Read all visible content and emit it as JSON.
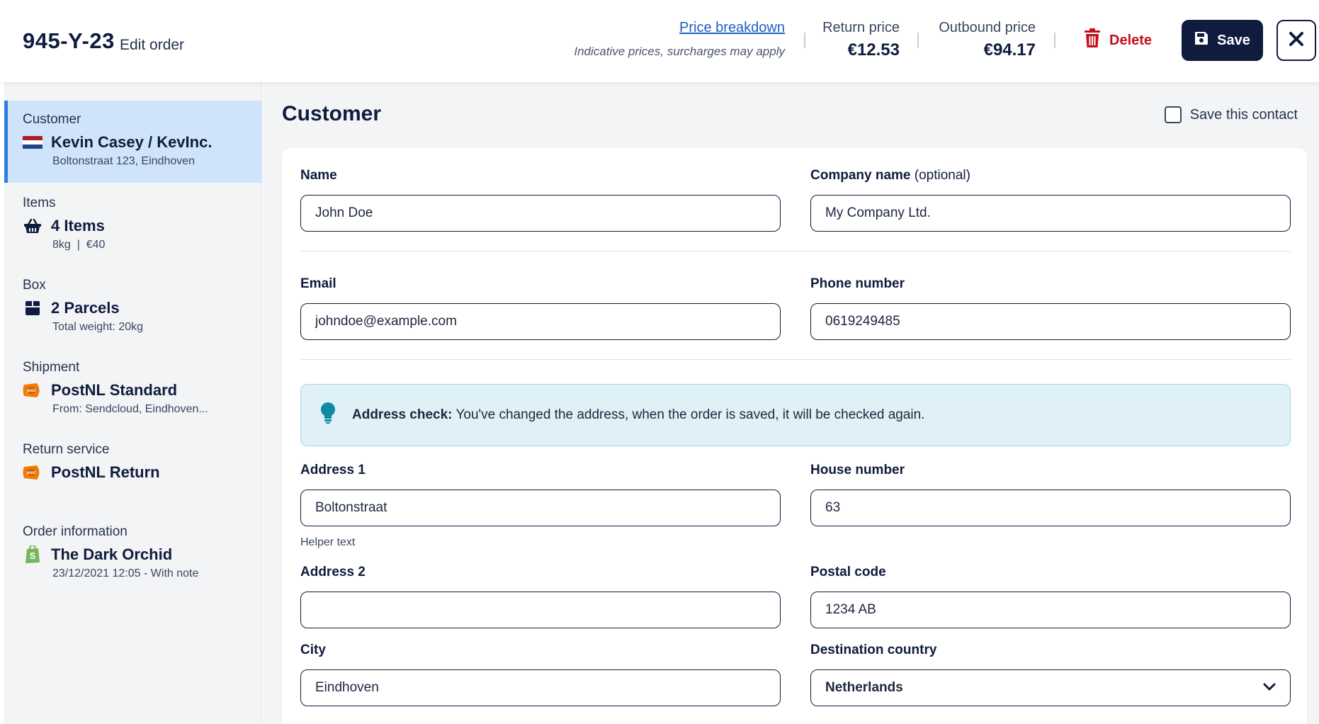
{
  "header": {
    "order_id": "945-Y-23",
    "edit_label": "Edit order",
    "price_breakdown": "Price breakdown",
    "indicative_note": "Indicative prices, surcharges may apply",
    "return_price_label": "Return price",
    "return_price_value": "€12.53",
    "outbound_price_label": "Outbound price",
    "outbound_price_value": "€94.17",
    "delete_label": "Delete",
    "save_label": "Save"
  },
  "sidebar": {
    "items": [
      {
        "category": "Customer",
        "title": "Kevin Casey / KevInc.",
        "subtitle": "Boltonstraat 123, Eindhoven",
        "icon": "netherlands-flag-icon"
      },
      {
        "category": "Items",
        "title": "4 Items",
        "subtitle": "8kg  |  €40",
        "icon": "basket-icon"
      },
      {
        "category": "Box",
        "title": "2 Parcels",
        "subtitle": "Total weight: 20kg",
        "icon": "box-icon"
      },
      {
        "category": "Shipment",
        "title": "PostNL Standard",
        "subtitle": "From: Sendcloud, Eindhoven...",
        "icon": "postnl-icon"
      },
      {
        "category": "Return service",
        "title": "PostNL Return",
        "subtitle": "",
        "icon": "postnl-icon"
      },
      {
        "category": "Order information",
        "title": "The Dark Orchid",
        "subtitle": "23/12/2021 12:05 - With note",
        "icon": "shopify-icon"
      }
    ]
  },
  "main": {
    "title": "Customer",
    "save_contact_label": "Save this contact",
    "fields": {
      "name": {
        "label": "Name",
        "value": "John Doe"
      },
      "company": {
        "label": "Company name",
        "optional": "(optional)",
        "value": "My Company Ltd."
      },
      "email": {
        "label": "Email",
        "value": "johndoe@example.com"
      },
      "phone": {
        "label": "Phone number",
        "value": "0619249485"
      },
      "address1": {
        "label": "Address 1",
        "value": "Boltonstraat",
        "helper": "Helper text"
      },
      "house_number": {
        "label": "House number",
        "value": "63"
      },
      "address2": {
        "label": "Address 2",
        "value": ""
      },
      "postal_code": {
        "label": "Postal code",
        "value": "1234 AB"
      },
      "city": {
        "label": "City",
        "value": "Eindhoven"
      },
      "country": {
        "label": "Destination country",
        "value": "Netherlands"
      }
    },
    "alert": {
      "bold": "Address check:",
      "text": "You've changed the address, when the order is saved, it will be checked again."
    }
  },
  "colors": {
    "navy": "#0f1c3d",
    "link_blue": "#1f5fc6",
    "delete_red": "#c0101c",
    "active_bg": "#cfe3fb",
    "active_border": "#2e7de0",
    "alert_bg": "#dff1f6",
    "postnl_orange": "#f07d00",
    "shopify_green": "#7ab55c"
  }
}
